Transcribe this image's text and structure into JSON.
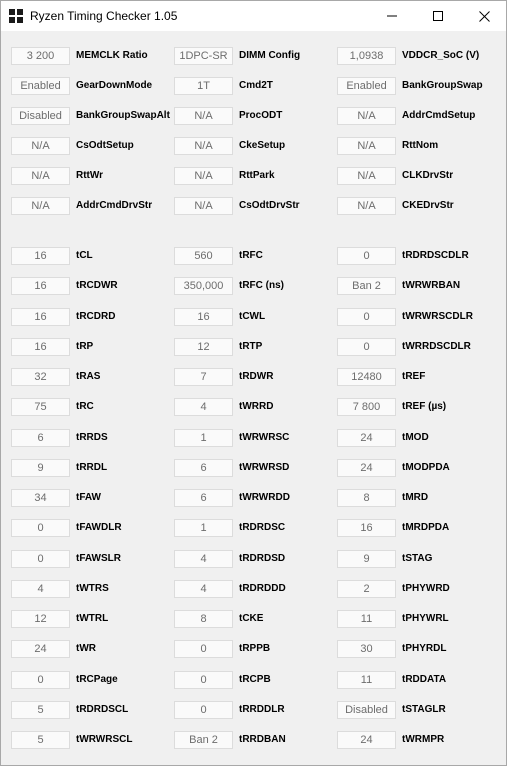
{
  "window": {
    "title": "Ryzen Timing Checker 1.05",
    "icons": {
      "app": "grid-app-icon",
      "minimize": "minimize-icon",
      "maximize": "maximize-icon",
      "close": "close-icon"
    }
  },
  "config_rows": [
    [
      {
        "value": "3 200",
        "label": "MEMCLK Ratio"
      },
      {
        "value": "1DPC-SR",
        "label": "DIMM Config"
      },
      {
        "value": "1,0938",
        "label": "VDDCR_SoC (V)"
      }
    ],
    [
      {
        "value": "Enabled",
        "label": "GearDownMode"
      },
      {
        "value": "1T",
        "label": "Cmd2T"
      },
      {
        "value": "Enabled",
        "label": "BankGroupSwap"
      }
    ],
    [
      {
        "value": "Disabled",
        "label": "BankGroupSwapAlt"
      },
      {
        "value": "N/A",
        "label": "ProcODT"
      },
      {
        "value": "N/A",
        "label": "AddrCmdSetup"
      }
    ],
    [
      {
        "value": "N/A",
        "label": "CsOdtSetup"
      },
      {
        "value": "N/A",
        "label": "CkeSetup"
      },
      {
        "value": "N/A",
        "label": "RttNom"
      }
    ],
    [
      {
        "value": "N/A",
        "label": "RttWr"
      },
      {
        "value": "N/A",
        "label": "RttPark"
      },
      {
        "value": "N/A",
        "label": "CLKDrvStr"
      }
    ],
    [
      {
        "value": "N/A",
        "label": "AddrCmdDrvStr"
      },
      {
        "value": "N/A",
        "label": "CsOdtDrvStr"
      },
      {
        "value": "N/A",
        "label": "CKEDrvStr"
      }
    ]
  ],
  "timing_rows": [
    [
      {
        "value": "16",
        "label": "tCL"
      },
      {
        "value": "560",
        "label": "tRFC"
      },
      {
        "value": "0",
        "label": "tRDRDSCDLR"
      }
    ],
    [
      {
        "value": "16",
        "label": "tRCDWR"
      },
      {
        "value": "350,000",
        "label": "tRFC (ns)"
      },
      {
        "value": "Ban 2",
        "label": "tWRWRBAN"
      }
    ],
    [
      {
        "value": "16",
        "label": "tRCDRD"
      },
      {
        "value": "16",
        "label": "tCWL"
      },
      {
        "value": "0",
        "label": "tWRWRSCDLR"
      }
    ],
    [
      {
        "value": "16",
        "label": "tRP"
      },
      {
        "value": "12",
        "label": "tRTP"
      },
      {
        "value": "0",
        "label": "tWRRDSCDLR"
      }
    ],
    [
      {
        "value": "32",
        "label": "tRAS"
      },
      {
        "value": "7",
        "label": "tRDWR"
      },
      {
        "value": "12480",
        "label": "tREF"
      }
    ],
    [
      {
        "value": "75",
        "label": "tRC"
      },
      {
        "value": "4",
        "label": "tWRRD"
      },
      {
        "value": "7 800",
        "label": "tREF (µs)"
      }
    ],
    [
      {
        "value": "6",
        "label": "tRRDS"
      },
      {
        "value": "1",
        "label": "tWRWRSC"
      },
      {
        "value": "24",
        "label": "tMOD"
      }
    ],
    [
      {
        "value": "9",
        "label": "tRRDL"
      },
      {
        "value": "6",
        "label": "tWRWRSD"
      },
      {
        "value": "24",
        "label": "tMODPDA"
      }
    ],
    [
      {
        "value": "34",
        "label": "tFAW"
      },
      {
        "value": "6",
        "label": "tWRWRDD"
      },
      {
        "value": "8",
        "label": "tMRD"
      }
    ],
    [
      {
        "value": "0",
        "label": "tFAWDLR"
      },
      {
        "value": "1",
        "label": "tRDRDSC"
      },
      {
        "value": "16",
        "label": "tMRDPDA"
      }
    ],
    [
      {
        "value": "0",
        "label": "tFAWSLR"
      },
      {
        "value": "4",
        "label": "tRDRDSD"
      },
      {
        "value": "9",
        "label": "tSTAG"
      }
    ],
    [
      {
        "value": "4",
        "label": "tWTRS"
      },
      {
        "value": "4",
        "label": "tRDRDDD"
      },
      {
        "value": "2",
        "label": "tPHYWRD"
      }
    ],
    [
      {
        "value": "12",
        "label": "tWTRL"
      },
      {
        "value": "8",
        "label": "tCKE"
      },
      {
        "value": "11",
        "label": "tPHYWRL"
      }
    ],
    [
      {
        "value": "24",
        "label": "tWR"
      },
      {
        "value": "0",
        "label": "tRPPB"
      },
      {
        "value": "30",
        "label": "tPHYRDL"
      }
    ],
    [
      {
        "value": "0",
        "label": "tRCPage"
      },
      {
        "value": "0",
        "label": "tRCPB"
      },
      {
        "value": "11",
        "label": "tRDDATA"
      }
    ],
    [
      {
        "value": "5",
        "label": "tRDRDSCL"
      },
      {
        "value": "0",
        "label": "tRRDDLR"
      },
      {
        "value": "Disabled",
        "label": "tSTAGLR"
      }
    ],
    [
      {
        "value": "5",
        "label": "tWRWRSCL"
      },
      {
        "value": "Ban 2",
        "label": "tRRDBAN"
      },
      {
        "value": "24",
        "label": "tWRMPR"
      }
    ]
  ]
}
